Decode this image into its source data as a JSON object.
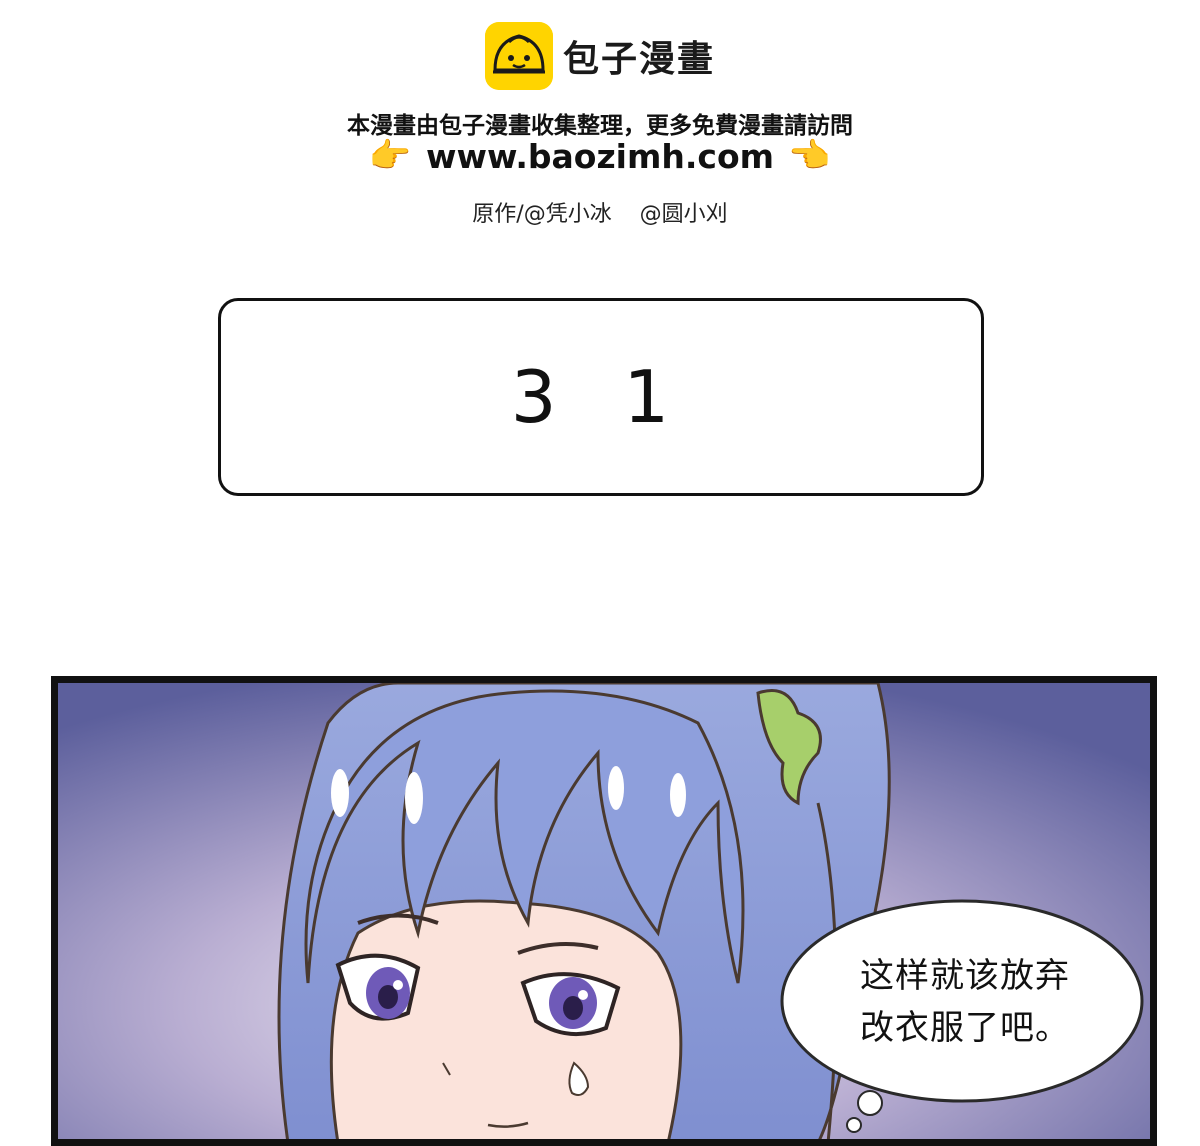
{
  "header": {
    "brand_name": "包子漫畫",
    "logo_icon": "bun-mascot-icon",
    "notice": "本漫畫由包子漫畫收集整理，更多免費漫畫請訪問",
    "url": "www.baozimh.com",
    "pointer_icon": "pointing-hand-icon",
    "credits": "原作/@凭小冰    @圆小刈"
  },
  "chapter": {
    "number": "3 1"
  },
  "panel": {
    "speech_lines": [
      "这样就该放弃",
      "改衣服了吧。"
    ]
  },
  "colors": {
    "logo_yellow": "#ffd400",
    "hair_blue": "#8a9ad8",
    "background_purple": "#6f72ae",
    "ribbon_green": "#a7cf6b"
  }
}
